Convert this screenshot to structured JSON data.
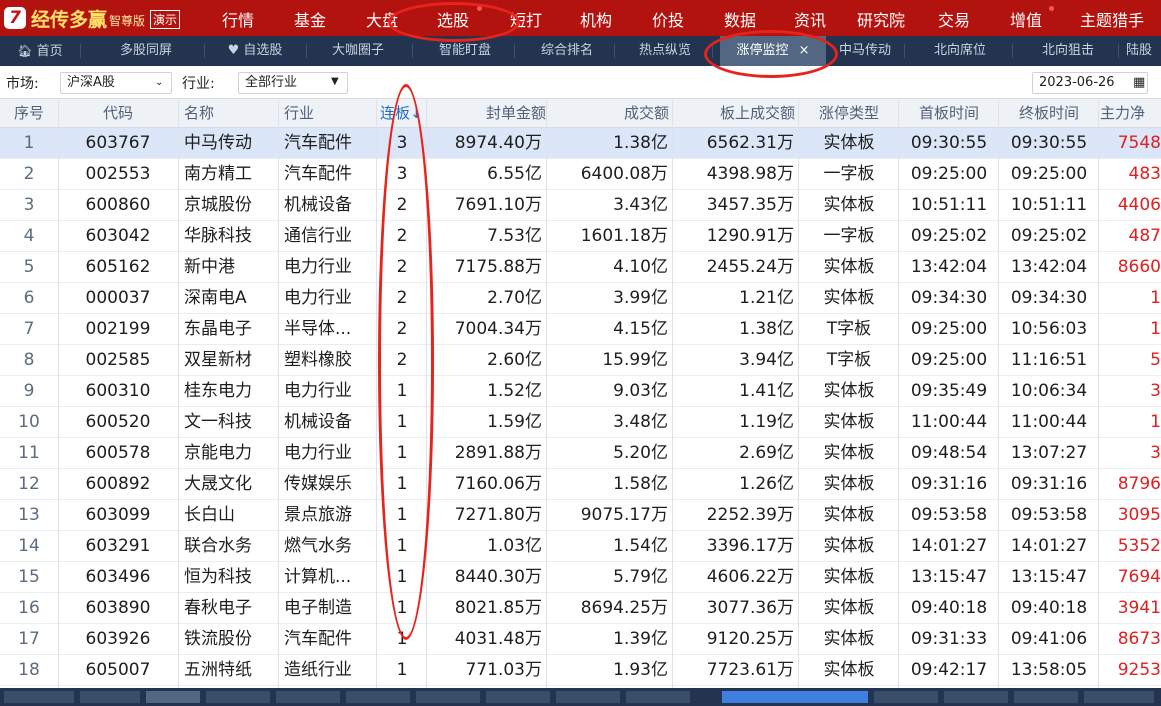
{
  "app": {
    "logo_char": "7",
    "name": "经传多赢",
    "edition": "智尊版",
    "demo": "演示"
  },
  "menu": [
    "行情",
    "基金",
    "大盘",
    "选股",
    "短打",
    "机构",
    "价投",
    "数据",
    "资讯",
    "研究院",
    "交易",
    "增值",
    "主题猎手"
  ],
  "tabs": [
    "首页",
    "多股同屏",
    "自选股",
    "大咖圈子",
    "智能盯盘",
    "综合排名",
    "热点纵览",
    "涨停监控",
    "中马传动",
    "北向席位",
    "北向狙击",
    "陆股"
  ],
  "tab_close": "×",
  "filter": {
    "market_label": "市场:",
    "market_value": "沪深A股",
    "industry_label": "行业:",
    "industry_value": "全部行业",
    "date": "2023-06-26"
  },
  "columns": [
    "序号",
    "代码",
    "名称",
    "行业",
    "连板↓",
    "封单金额",
    "成交额",
    "板上成交额",
    "涨停类型",
    "首板时间",
    "终板时间",
    "主力净"
  ],
  "rows": [
    [
      "1",
      "603767",
      "中马传动",
      "汽车配件",
      "3",
      "8974.40万",
      "1.38亿",
      "6562.31万",
      "实体板",
      "09:30:55",
      "09:30:55",
      "7548"
    ],
    [
      "2",
      "002553",
      "南方精工",
      "汽车配件",
      "3",
      "6.55亿",
      "6400.08万",
      "4398.98万",
      "一字板",
      "09:25:00",
      "09:25:00",
      "483"
    ],
    [
      "3",
      "600860",
      "京城股份",
      "机械设备",
      "2",
      "7691.10万",
      "3.43亿",
      "3457.35万",
      "实体板",
      "10:51:11",
      "10:51:11",
      "4406"
    ],
    [
      "4",
      "603042",
      "华脉科技",
      "通信行业",
      "2",
      "7.53亿",
      "1601.18万",
      "1290.91万",
      "一字板",
      "09:25:02",
      "09:25:02",
      "487"
    ],
    [
      "5",
      "605162",
      "新中港",
      "电力行业",
      "2",
      "7175.88万",
      "4.10亿",
      "2455.24万",
      "实体板",
      "13:42:04",
      "13:42:04",
      "8660"
    ],
    [
      "6",
      "000037",
      "深南电A",
      "电力行业",
      "2",
      "2.70亿",
      "3.99亿",
      "1.21亿",
      "实体板",
      "09:34:30",
      "09:34:30",
      "1"
    ],
    [
      "7",
      "002199",
      "东晶电子",
      "半导体...",
      "2",
      "7004.34万",
      "4.15亿",
      "1.38亿",
      "T字板",
      "09:25:00",
      "10:56:03",
      "1"
    ],
    [
      "8",
      "002585",
      "双星新材",
      "塑料橡胶",
      "2",
      "2.60亿",
      "15.99亿",
      "3.94亿",
      "T字板",
      "09:25:00",
      "11:16:51",
      "5"
    ],
    [
      "9",
      "600310",
      "桂东电力",
      "电力行业",
      "1",
      "1.52亿",
      "9.03亿",
      "1.41亿",
      "实体板",
      "09:35:49",
      "10:06:34",
      "3"
    ],
    [
      "10",
      "600520",
      "文一科技",
      "机械设备",
      "1",
      "1.59亿",
      "3.48亿",
      "1.19亿",
      "实体板",
      "11:00:44",
      "11:00:44",
      "1"
    ],
    [
      "11",
      "600578",
      "京能电力",
      "电力行业",
      "1",
      "2891.88万",
      "5.20亿",
      "2.69亿",
      "实体板",
      "09:48:54",
      "13:07:27",
      "3"
    ],
    [
      "12",
      "600892",
      "大晟文化",
      "传媒娱乐",
      "1",
      "7160.06万",
      "1.58亿",
      "1.26亿",
      "实体板",
      "09:31:16",
      "09:31:16",
      "8796"
    ],
    [
      "13",
      "603099",
      "长白山",
      "景点旅游",
      "1",
      "7271.80万",
      "9075.17万",
      "2252.39万",
      "实体板",
      "09:53:58",
      "09:53:58",
      "3095"
    ],
    [
      "14",
      "603291",
      "联合水务",
      "燃气水务",
      "1",
      "1.03亿",
      "1.54亿",
      "3396.17万",
      "实体板",
      "14:01:27",
      "14:01:27",
      "5352"
    ],
    [
      "15",
      "603496",
      "恒为科技",
      "计算机...",
      "1",
      "8440.30万",
      "5.79亿",
      "4606.22万",
      "实体板",
      "13:15:47",
      "13:15:47",
      "7694"
    ],
    [
      "16",
      "603890",
      "春秋电子",
      "电子制造",
      "1",
      "8021.85万",
      "8694.25万",
      "3077.36万",
      "实体板",
      "09:40:18",
      "09:40:18",
      "3941"
    ],
    [
      "17",
      "603926",
      "铁流股份",
      "汽车配件",
      "1",
      "4031.48万",
      "1.39亿",
      "9120.25万",
      "实体板",
      "09:31:33",
      "09:41:06",
      "8673"
    ],
    [
      "18",
      "605007",
      "五洲特纸",
      "造纸行业",
      "1",
      "771.03万",
      "1.93亿",
      "7723.61万",
      "实体板",
      "09:42:17",
      "13:58:05",
      "9253"
    ]
  ],
  "colors": {
    "brand": "#b3130f",
    "tabbar": "#22344f",
    "selected_tab": "#536783",
    "highlight_row": "#dbe6f8",
    "positive": "#e02020",
    "annotation": "#e8231b"
  }
}
